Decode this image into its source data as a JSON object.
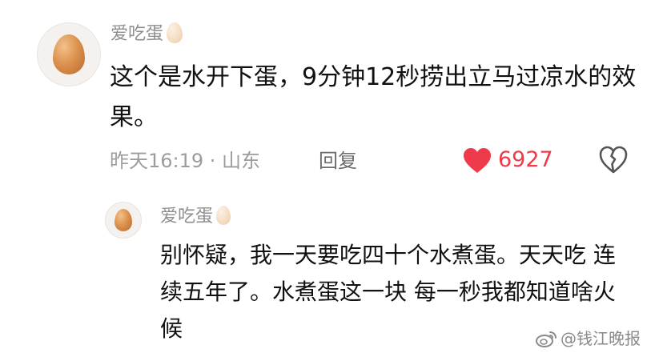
{
  "comment": {
    "username": "爱吃蛋",
    "text": "这个是水开下蛋，9分钟12秒捞出立马过凉水的效果。",
    "time_location": "昨天16:19 · 山东",
    "reply_label": "回复",
    "likes": "6927",
    "icons": {
      "avatar": "egg-avatar",
      "username_badge": "egg-icon",
      "like": "heart-icon",
      "dislike": "broken-heart-icon"
    },
    "colors": {
      "like": "#ee3a4a",
      "username": "#8e8e8e",
      "meta": "#9c9c9c"
    }
  },
  "reply": {
    "username": "爱吃蛋",
    "text": "别怀疑，我一天要吃四十个水煮蛋。天天吃 连续五年了。水煮蛋这一块 每一秒我都知道啥火候",
    "icons": {
      "avatar": "egg-avatar",
      "username_badge": "egg-icon"
    }
  },
  "watermark": {
    "text": "@钱江晚报",
    "icon": "weibo-icon"
  }
}
